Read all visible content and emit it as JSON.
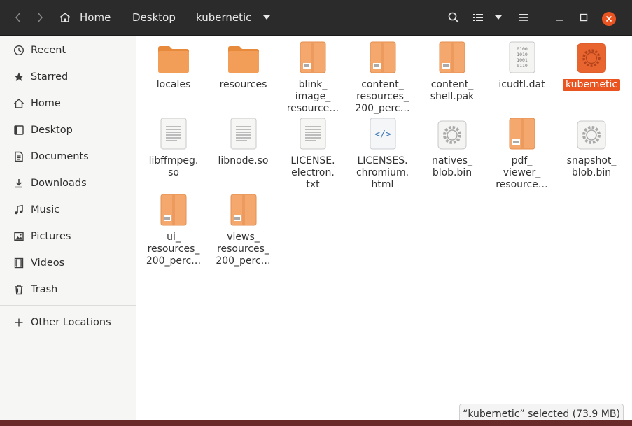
{
  "titlebar": {
    "breadcrumbs": [
      "Home",
      "Desktop",
      "kubernetic"
    ],
    "back_icon": "chevron-left-icon",
    "forward_icon": "chevron-right-icon",
    "home_icon": "home-icon"
  },
  "sidebar": {
    "items": [
      {
        "label": "Recent",
        "icon": "clock-icon"
      },
      {
        "label": "Starred",
        "icon": "star-icon"
      },
      {
        "label": "Home",
        "icon": "home-icon"
      },
      {
        "label": "Desktop",
        "icon": "desktop-icon"
      },
      {
        "label": "Documents",
        "icon": "document-icon"
      },
      {
        "label": "Downloads",
        "icon": "download-icon"
      },
      {
        "label": "Music",
        "icon": "music-icon"
      },
      {
        "label": "Pictures",
        "icon": "picture-icon"
      },
      {
        "label": "Videos",
        "icon": "film-icon"
      },
      {
        "label": "Trash",
        "icon": "trash-icon"
      }
    ],
    "other_locations": "Other Locations"
  },
  "files": [
    {
      "label": "locales",
      "kind": "folder"
    },
    {
      "label": "resources",
      "kind": "folder"
    },
    {
      "label": "blink_\nimage_\nresource…",
      "kind": "archive"
    },
    {
      "label": "content_\nresources_\n200_perc…",
      "kind": "archive"
    },
    {
      "label": "content_\nshell.pak",
      "kind": "archive"
    },
    {
      "label": "icudtl.dat",
      "kind": "binary"
    },
    {
      "label": "kubernetic",
      "kind": "executable",
      "selected": true
    },
    {
      "label": "libffmpeg.\nso",
      "kind": "text"
    },
    {
      "label": "libnode.so",
      "kind": "text"
    },
    {
      "label": "LICENSE.\nelectron.\ntxt",
      "kind": "text"
    },
    {
      "label": "LICENSES.\nchromium.\nhtml",
      "kind": "html"
    },
    {
      "label": "natives_\nblob.bin",
      "kind": "gear"
    },
    {
      "label": "pdf_\nviewer_\nresource…",
      "kind": "archive"
    },
    {
      "label": "snapshot_\nblob.bin",
      "kind": "gear"
    },
    {
      "label": "ui_\nresources_\n200_perc…",
      "kind": "archive"
    },
    {
      "label": "views_\nresources_\n200_perc…",
      "kind": "archive"
    }
  ],
  "status": "“kubernetic” selected  (73.9 MB)",
  "colors": {
    "accent": "#e95420",
    "headerbar": "#2b2b2b",
    "folder": "#f39e58"
  }
}
